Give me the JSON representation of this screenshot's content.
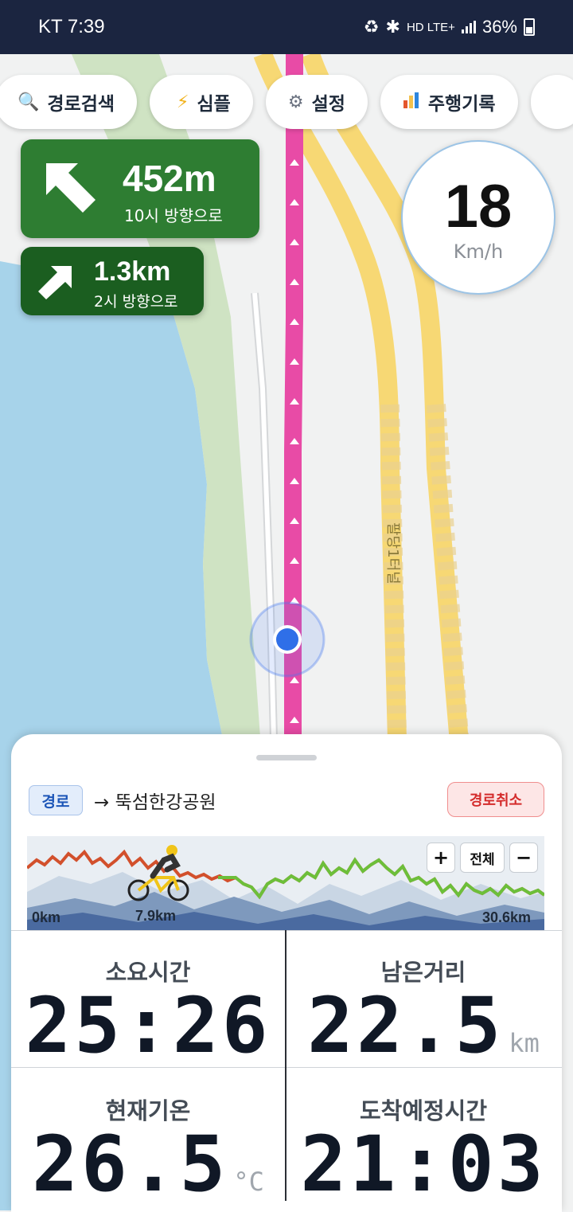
{
  "status_bar": {
    "carrier_time": "KT 7:39",
    "network": "HD LTE+",
    "battery": "36%"
  },
  "toolbar": {
    "items": [
      {
        "label": "경로검색",
        "icon": "search-icon"
      },
      {
        "label": "심플",
        "icon": "lightning-icon"
      },
      {
        "label": "설정",
        "icon": "gear-icon"
      },
      {
        "label": "주행기록",
        "icon": "bar-chart-icon"
      }
    ]
  },
  "navigation": {
    "next_turn": {
      "distance": "452m",
      "direction": "10시 방향으로",
      "icon": "arrow-up-left-icon"
    },
    "following_turn": {
      "distance": "1.3km",
      "direction": "2시 방향으로",
      "icon": "arrow-up-right-icon"
    }
  },
  "speed": {
    "value": "18",
    "unit": "Km/h"
  },
  "map": {
    "labels": [
      "팔당1터널"
    ],
    "route_color": "#e84ba6"
  },
  "route": {
    "badge": "경로",
    "destination": "→ 뚝섬한강공원",
    "cancel_label": "경로취소"
  },
  "elevation": {
    "start_label": "0km",
    "current_label": "7.9km",
    "end_label": "30.6km",
    "zoom_in": "+",
    "zoom_all": "전체",
    "zoom_out": "−",
    "progress_fraction": 0.258
  },
  "stats": {
    "elapsed": {
      "label": "소요시간",
      "value": "25:26"
    },
    "remaining": {
      "label": "남은거리",
      "value": "22.5",
      "unit": "km"
    },
    "temperature": {
      "label": "현재기온",
      "value": "26.5",
      "unit": "°C"
    },
    "eta": {
      "label": "도착예정시간",
      "value": "21:03"
    }
  },
  "colors": {
    "status_bar": "#1b2540",
    "turn_primary": "#2e7d32",
    "turn_secondary": "#1b5e20",
    "route": "#e84ba6",
    "road": "#f7d874",
    "water": "#a7d3ea"
  }
}
